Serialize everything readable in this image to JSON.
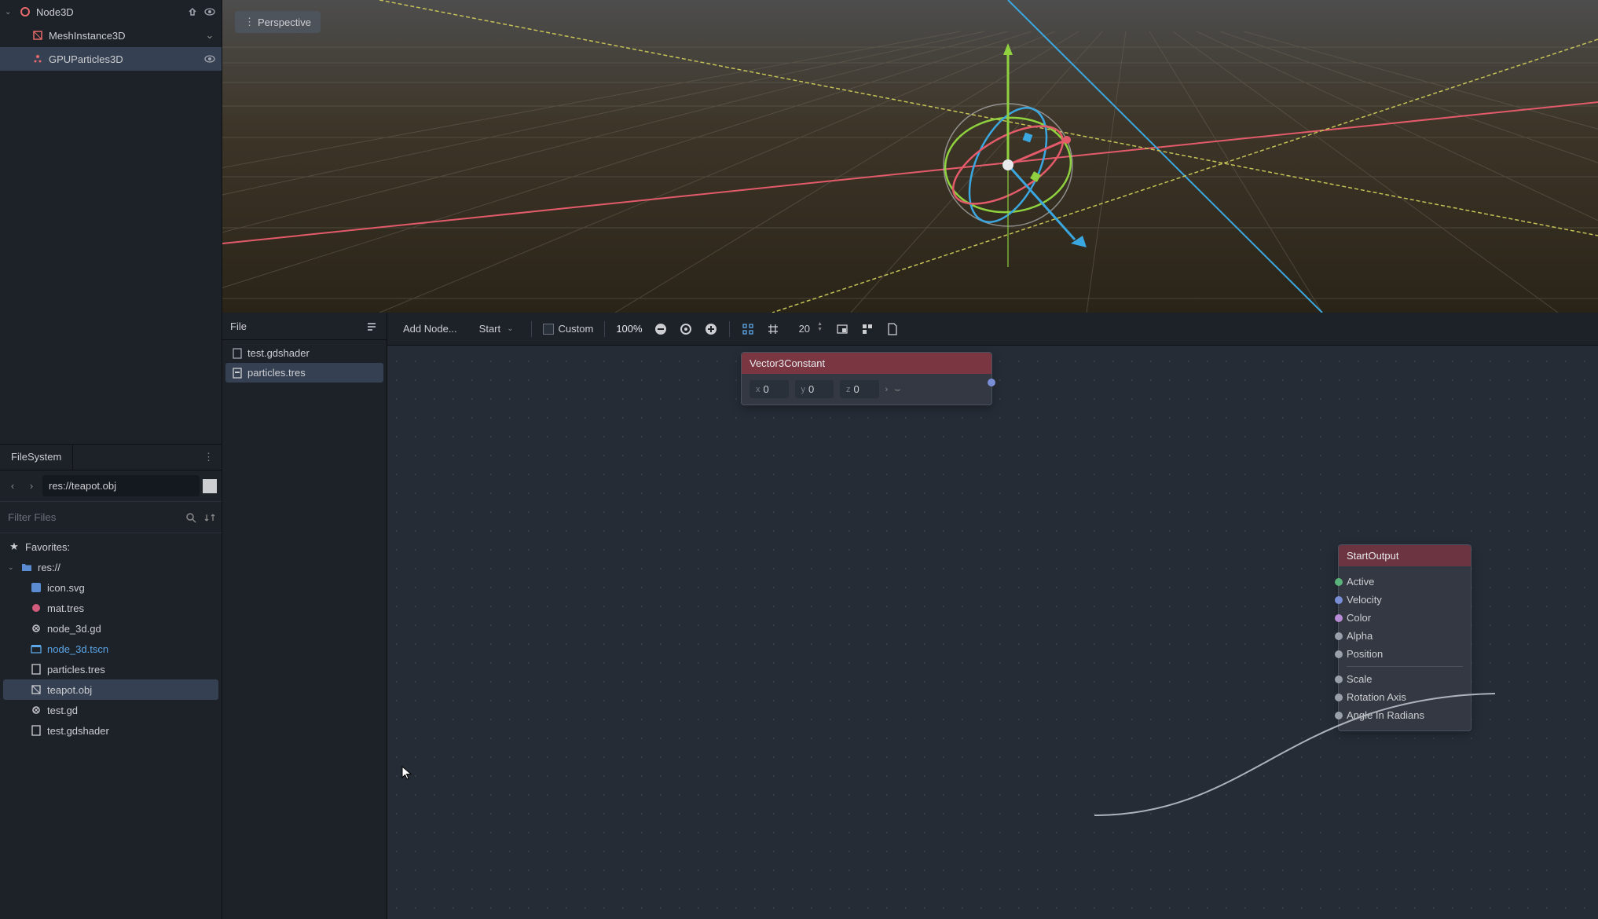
{
  "scene_tree": {
    "root": {
      "label": "Node3D",
      "icon": "node3d",
      "expanded": true
    },
    "children": [
      {
        "label": "MeshInstance3D",
        "icon": "mesh",
        "selected": false
      },
      {
        "label": "GPUParticles3D",
        "icon": "particles",
        "selected": true
      }
    ]
  },
  "viewport": {
    "perspective_label": "Perspective"
  },
  "file_panel": {
    "header": "File",
    "items": [
      {
        "label": "test.gdshader",
        "selected": false
      },
      {
        "label": "particles.tres",
        "selected": true
      }
    ]
  },
  "graph_toolbar": {
    "add_node": "Add Node...",
    "mode_dropdown": "Start",
    "custom_label": "Custom",
    "zoom": "100%",
    "snap_value": "20"
  },
  "graph_nodes": {
    "vec3": {
      "title": "Vector3Constant",
      "x_label": "x",
      "x_value": "0",
      "y_label": "y",
      "y_value": "0",
      "z_label": "z",
      "z_value": "0"
    },
    "start_output": {
      "title": "StartOutput",
      "ports": [
        {
          "label": "Active",
          "color": "#5bb17a"
        },
        {
          "label": "Velocity",
          "color": "#7a8ed6"
        },
        {
          "label": "Color",
          "color": "#b88bd6"
        },
        {
          "label": "Alpha",
          "color": "#9aa0ab"
        },
        {
          "label": "Position",
          "color": "#9aa0ab"
        },
        {
          "label": "Scale",
          "color": "#9aa0ab"
        },
        {
          "label": "Rotation Axis",
          "color": "#9aa0ab"
        },
        {
          "label": "Angle In Radians",
          "color": "#9aa0ab"
        }
      ]
    }
  },
  "filesystem": {
    "tab": "FileSystem",
    "path": "res://teapot.obj",
    "filter_placeholder": "Filter Files",
    "favorites_label": "Favorites:",
    "root_label": "res://",
    "files": [
      {
        "label": "icon.svg",
        "icon": "image",
        "color": "#5b8bd1"
      },
      {
        "label": "mat.tres",
        "icon": "material",
        "color": "#d15b7a"
      },
      {
        "label": "node_3d.gd",
        "icon": "script",
        "color": "#cdced2"
      },
      {
        "label": "node_3d.tscn",
        "icon": "scene",
        "color": "#5ca8e8",
        "link": true
      },
      {
        "label": "particles.tres",
        "icon": "resource",
        "color": "#cdced2"
      },
      {
        "label": "teapot.obj",
        "icon": "mesh",
        "color": "#cdced2",
        "selected": true
      },
      {
        "label": "test.gd",
        "icon": "script",
        "color": "#cdced2"
      },
      {
        "label": "test.gdshader",
        "icon": "shader",
        "color": "#cdced2"
      }
    ]
  }
}
